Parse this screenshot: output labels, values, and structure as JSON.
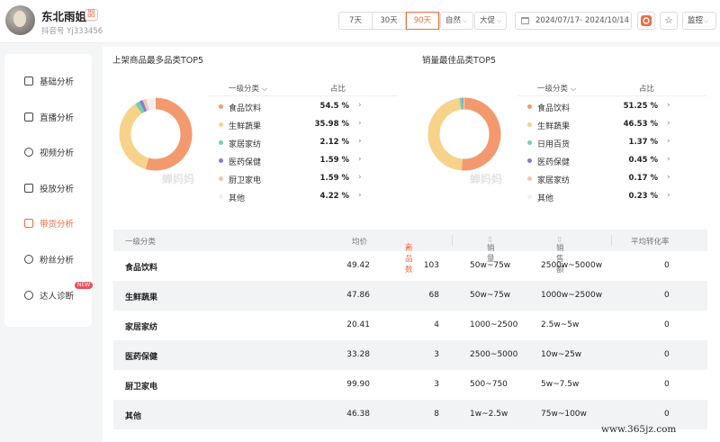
{
  "header": {
    "name": "东北雨姐",
    "badge": "㗊",
    "account": "抖音号 Yj333456",
    "ranges": [
      "7天",
      "30天",
      "90天"
    ],
    "active_range": "90天",
    "filter1": "自然",
    "filter2": "大促",
    "date_start": "2024/07/17",
    "date_sep": "~",
    "date_end": "2024/10/14",
    "monitor_label": "监控"
  },
  "sidebar": {
    "items": [
      {
        "label": "基础分析",
        "icon": "chart-icon"
      },
      {
        "label": "直播分析",
        "icon": "live-icon"
      },
      {
        "label": "视频分析",
        "icon": "play-icon"
      },
      {
        "label": "投放分析",
        "icon": "promotion-icon"
      },
      {
        "label": "带货分析",
        "icon": "bag-icon"
      },
      {
        "label": "粉丝分析",
        "icon": "fans-icon"
      },
      {
        "label": "达人诊断",
        "icon": "diagnosis-icon"
      }
    ],
    "active_index": 4,
    "new_tag": "NEW"
  },
  "left_panel": {
    "title": "上架商品最多品类TOP5",
    "col1": "一级分类",
    "col2": "占比",
    "watermark": "蝉妈妈"
  },
  "right_panel": {
    "title": "销量最佳品类TOP5",
    "col1": "一级分类",
    "col2": "占比",
    "watermark": "蝉妈妈"
  },
  "chart_data": [
    {
      "type": "pie",
      "title": "上架商品最多品类TOP5",
      "categories": [
        "食品饮料",
        "生鲜蔬果",
        "家居家纺",
        "医药保健",
        "厨卫家电",
        "其他"
      ],
      "values": [
        54.5,
        35.98,
        2.12,
        1.59,
        1.59,
        4.22
      ],
      "labels": [
        "54.5 %",
        "35.98 %",
        "2.12 %",
        "1.59 %",
        "1.59 %",
        "4.22 %"
      ],
      "colors": [
        "#f29a6e",
        "#f7d28a",
        "#7ccfa9",
        "#7b7fe0",
        "#f5c6a4",
        "#f1f1f1"
      ]
    },
    {
      "type": "pie",
      "title": "销量最佳品类TOP5",
      "categories": [
        "食品饮料",
        "生鲜蔬果",
        "日用百货",
        "医药保健",
        "家居家纺",
        "其他"
      ],
      "values": [
        51.25,
        46.53,
        1.37,
        0.45,
        0.17,
        0.23
      ],
      "labels": [
        "51.25 %",
        "46.53 %",
        "1.37 %",
        "0.45 %",
        "0.17 %",
        "0.23 %"
      ],
      "colors": [
        "#f29a6e",
        "#f7d28a",
        "#7ccfa9",
        "#7b7fe0",
        "#f5c6a4",
        "#f1f1f1"
      ]
    }
  ],
  "table": {
    "headers": [
      "一级分类",
      "均价",
      "商品数",
      "销量",
      "销售额",
      "平均转化率"
    ],
    "sorted_header_suffix": "⇣",
    "sort_icon": "⇳",
    "rows": [
      [
        "食品饮料",
        "49.42",
        "103",
        "50w~75w",
        "2500w~5000w",
        "0"
      ],
      [
        "生鲜蔬果",
        "47.86",
        "68",
        "50w~75w",
        "1000w~2500w",
        "0"
      ],
      [
        "家居家纺",
        "20.41",
        "4",
        "1000~2500",
        "2.5w~5w",
        "0"
      ],
      [
        "医药保健",
        "33.28",
        "3",
        "2500~5000",
        "10w~25w",
        "0"
      ],
      [
        "厨卫家电",
        "99.90",
        "3",
        "500~750",
        "5w~7.5w",
        "0"
      ],
      [
        "其他",
        "46.38",
        "8",
        "1w~2.5w",
        "75w~100w",
        "0"
      ]
    ]
  },
  "site_mark": "www.365jz.com"
}
